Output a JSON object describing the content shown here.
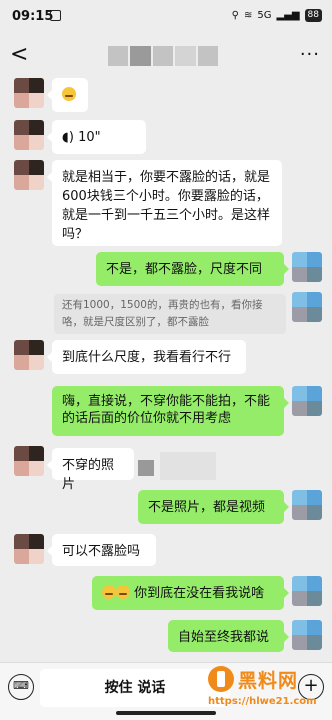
{
  "status": {
    "time": "09:15",
    "battery": "88",
    "network": "5G"
  },
  "nav": {
    "back": "<",
    "more": "···"
  },
  "messages": [
    {
      "text": ""
    },
    {
      "text": "10\""
    },
    {
      "text": "就是相当于，你要不露脸的话，就是600块钱三个小时。你要露脸的话，就是一千到一千五三个小时。是这样吗？"
    },
    {
      "text": "不是，都不露脸，尺度不同"
    },
    {
      "text": "还有1000，1500的，再贵的也有，看你接咯，就是尺度区别了，都不露脸"
    },
    {
      "text": "到底什么尺度，我看看行不行"
    },
    {
      "text": "嗨，直接说，不穿你能不能拍，不能的话后面的价位你就不用考虑"
    },
    {
      "text": "不穿的照片"
    },
    {
      "text": "不是照片，都是视频"
    },
    {
      "text": "可以不露脸吗"
    },
    {
      "text": "你到底在没在看我说啥"
    },
    {
      "text": "自始至终我都说"
    }
  ],
  "input": {
    "hold_to_talk": "按住 说话"
  },
  "watermark": {
    "name": "黑料网",
    "url": "https://hlwe21.com"
  }
}
